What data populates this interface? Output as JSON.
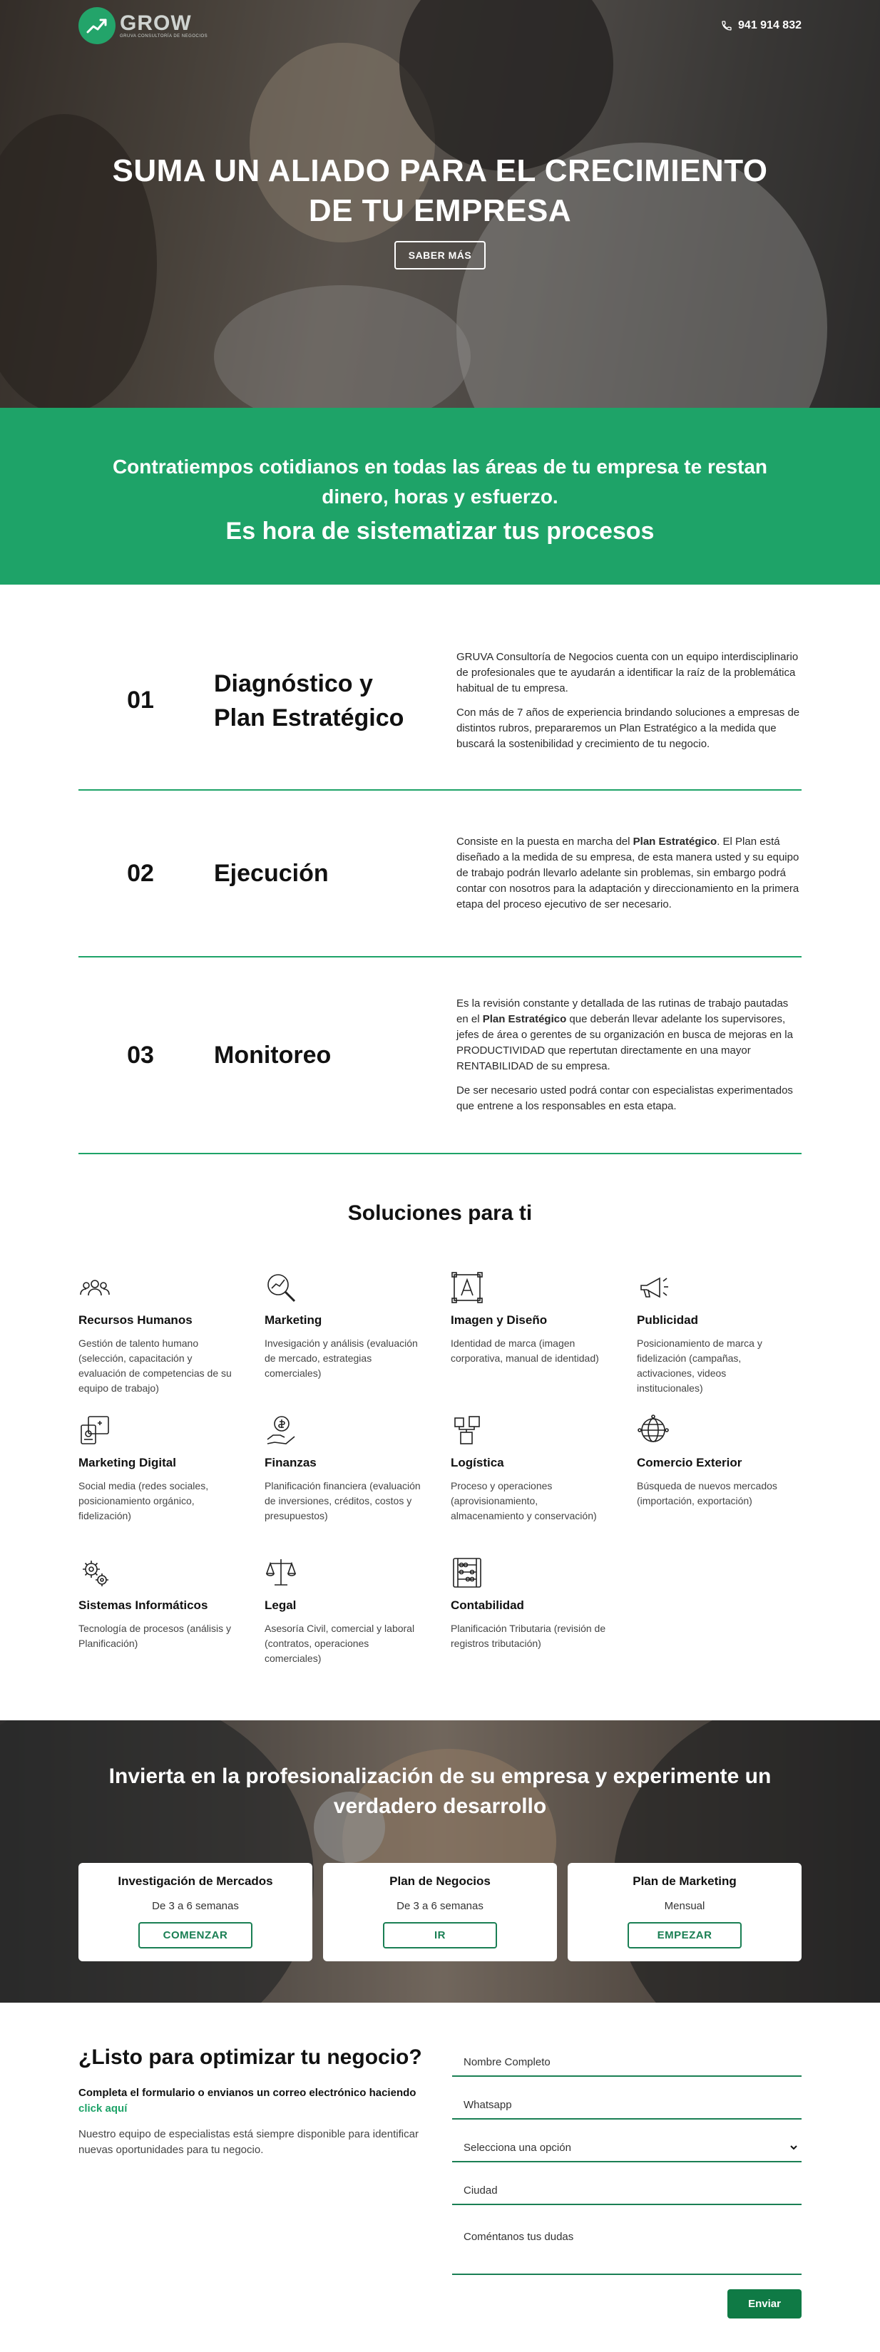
{
  "header": {
    "logo_text": "GROW",
    "logo_sub": "GRUVA CONSULTORÍA DE NEGOCIOS",
    "phone": "941 914 832"
  },
  "hero": {
    "title_line1": "SUMA UN ALIADO PARA EL CRECIMIENTO",
    "title_line2": "DE TU EMPRESA",
    "button": "SABER MÁS"
  },
  "band": {
    "line1": "Contratiempos cotidianos en todas las áreas de tu empresa te restan dinero, horas y esfuerzo.",
    "line2": "Es hora de sistematizar tus procesos"
  },
  "steps": [
    {
      "num": "01",
      "title": "Diagnóstico y Plan Estratégico",
      "p1": "GRUVA Consultoría de Negocios cuenta con un equipo interdisciplinario de profesionales que te ayudarán a identificar la raíz de la problemática habitual de tu empresa.",
      "p2": "Con más de 7 años de experiencia brindando soluciones a empresas de distintos rubros, prepararemos un Plan Estratégico a la medida que buscará la sostenibilidad y crecimiento de tu negocio."
    },
    {
      "num": "02",
      "title": "Ejecución",
      "p1_a": "Consiste en la puesta en marcha del ",
      "p1_b": "Plan Estratégico",
      "p1_c": ". El Plan está diseñado a la medida de su empresa, de esta manera usted y su equipo de trabajo podrán llevarlo adelante sin problemas, sin embargo podrá contar con nosotros para la adaptación y direccionamiento en la primera etapa del proceso ejecutivo de ser necesario."
    },
    {
      "num": "03",
      "title": "Monitoreo",
      "p1_a": "Es la revisión constante y detallada de las rutinas de trabajo pautadas en el ",
      "p1_b": "Plan Estratégico",
      "p1_c": " que deberán llevar adelante los supervisores, jefes de área o gerentes de su organización en busca de mejoras en la PRODUCTIVIDAD que repertutan directamente en una mayor RENTABILIDAD de su empresa.",
      "p2": "De ser necesario usted podrá contar con especialistas experimentados que entrene a los responsables en esta etapa."
    }
  ],
  "solutions": {
    "title": "Soluciones para ti",
    "items": [
      {
        "name": "Recursos Humanos",
        "desc": "Gestión de talento humano (selección, capacitación y evaluación de competencias de su equipo de trabajo)",
        "icon": "team-icon"
      },
      {
        "name": "Marketing",
        "desc": "Invesigación y análisis (evaluación de mercado, estrategias comerciales)",
        "icon": "magnifier-chart-icon"
      },
      {
        "name": "Imagen y Diseño",
        "desc": "Identidad de marca (imagen corporativa, manual de identidad)",
        "icon": "design-icon"
      },
      {
        "name": "Publicidad",
        "desc": "Posicionamiento de marca y fidelización (campañas, activaciones, videos institucionales)",
        "icon": "megaphone-icon"
      },
      {
        "name": "Marketing Digital",
        "desc": "Social media (redes sociales, posicionamiento orgánico, fidelización)",
        "icon": "social-media-icon"
      },
      {
        "name": "Finanzas",
        "desc": "Planificación financiera (evaluación de inversiones, créditos, costos y presupuestos)",
        "icon": "money-hand-icon"
      },
      {
        "name": "Logística",
        "desc": "Proceso y operaciones (aprovisionamiento, almacenamiento y conservación)",
        "icon": "boxes-icon"
      },
      {
        "name": "Comercio Exterior",
        "desc": "Búsqueda de nuevos mercados (importación, exportación)",
        "icon": "globe-icon"
      },
      {
        "name": "Sistemas Informáticos",
        "desc": "Tecnología de procesos (análisis y Planificación)",
        "icon": "gears-icon"
      },
      {
        "name": "Legal",
        "desc": "Asesoría Civil, comercial y laboral (contratos, operaciones comerciales)",
        "icon": "scales-icon"
      },
      {
        "name": "Contabilidad",
        "desc": "Planificación Tributaria (revisión de registros tributación)",
        "icon": "abacus-icon"
      }
    ]
  },
  "invest": {
    "title_line1": "Invierta en la profesionalización de su empresa y experimente un",
    "title_line2": "verdadero desarrollo",
    "plans": [
      {
        "name": "Investigación de Mercados",
        "duration": "De 3 a 6 semanas",
        "button": "COMENZAR"
      },
      {
        "name": "Plan de Negocios",
        "duration": "De 3 a 6 semanas",
        "button": "IR"
      },
      {
        "name": "Plan de Marketing",
        "duration": "Mensual",
        "button": "EMPEZAR"
      }
    ]
  },
  "contact": {
    "title": "¿Listo para optimizar tu negocio?",
    "lead": "Completa el formulario o envianos un correo electrónico haciendo ",
    "lead_link": "click aquí",
    "info": "Nuestro equipo de especialistas está siempre disponible para identificar nuevas oportunidades para tu negocio.",
    "form": {
      "name_placeholder": "Nombre Completo",
      "whatsapp_placeholder": "Whatsapp",
      "select_value": "Selecciona una opción",
      "city_placeholder": "Ciudad",
      "comments_placeholder": "Coméntanos tus dudas",
      "submit": "Enviar"
    }
  },
  "colors": {
    "brand_green": "#1ea368",
    "button_green": "#0f7a45"
  }
}
